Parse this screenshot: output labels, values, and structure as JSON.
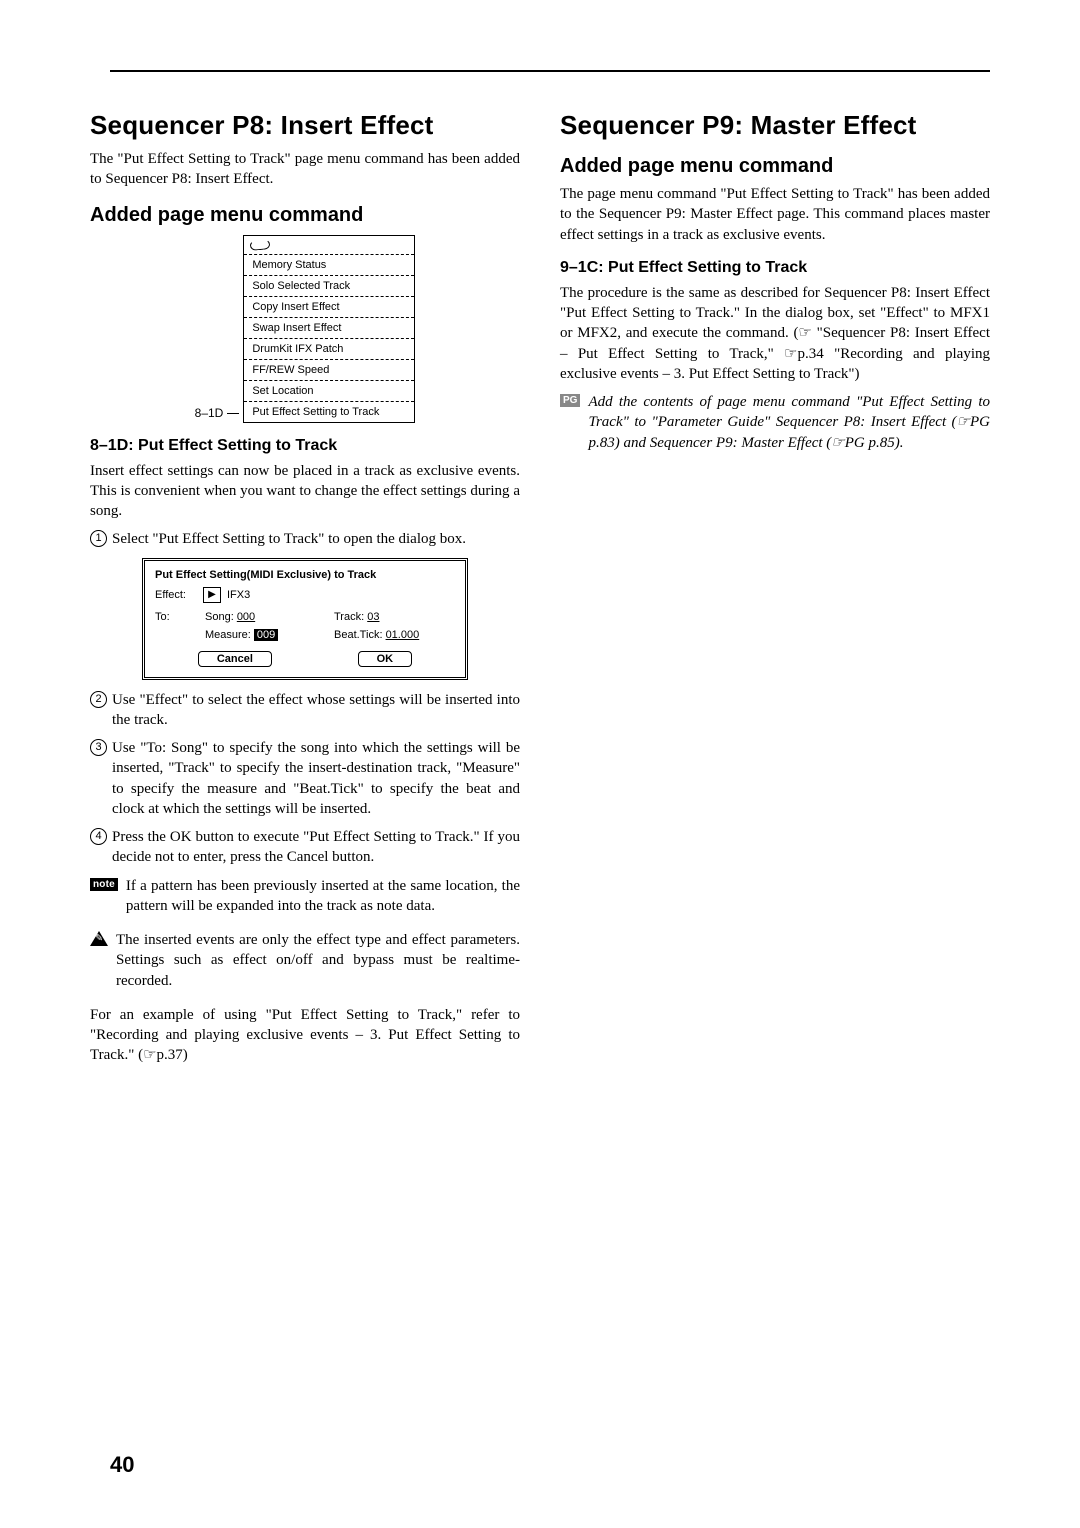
{
  "page_number": "40",
  "left": {
    "h1": "Sequencer P8: Insert Effect",
    "intro": "The \"Put Effect Setting to Track\" page menu command has been added to Sequencer P8: Insert Effect.",
    "h2": "Added page menu command",
    "menu_label": "8–1D",
    "menu_items": [
      "Memory Status",
      "Solo Selected Track",
      "Copy Insert Effect",
      "Swap Insert Effect",
      "DrumKit IFX Patch",
      "FF/REW Speed",
      "Set Location",
      "Put Effect Setting to Track"
    ],
    "h3": "8–1D: Put Effect Setting to Track",
    "p_after_h3": "Insert effect settings can now be placed in a track as exclusive events. This is convenient when you want to change the effect settings during a song.",
    "steps": [
      "Select \"Put Effect Setting to Track\" to open the dialog box.",
      "Use \"Effect\" to select the effect whose settings will be inserted into the track.",
      "Use \"To: Song\" to specify the song into which the settings will be inserted, \"Track\" to specify the insert-destination track, \"Measure\" to specify the measure and \"Beat.Tick\" to specify the beat and clock at which the settings will be inserted.",
      "Press the OK button to execute \"Put Effect Setting to Track.\" If you decide not to enter, press the Cancel button."
    ],
    "dialog": {
      "title": "Put Effect Setting(MIDI Exclusive) to Track",
      "effect_label": "Effect:",
      "effect_value": "IFX3",
      "to_label": "To:",
      "song_label": "Song:",
      "song_value": "000",
      "track_label": "Track:",
      "track_value": "03",
      "measure_label": "Measure:",
      "measure_value": "009",
      "beat_label": "Beat.Tick:",
      "beat_value": "01.000",
      "cancel": "Cancel",
      "ok": "OK"
    },
    "note_badge": "note",
    "note_text": "If a pattern has been previously inserted at the same location, the pattern will be expanded into the track as note data.",
    "warn_text": "The inserted events are only the effect type and effect parameters. Settings such as effect on/off and bypass must be realtime-recorded.",
    "closing": "For an example of using \"Put Effect Setting to Track,\" refer to \"Recording and playing exclusive events – 3. Put Effect Setting to Track.\" (☞p.37)"
  },
  "right": {
    "h1": "Sequencer P9: Master Effect",
    "h2": "Added page menu command",
    "intro": "The page menu command \"Put Effect Setting to Track\" has been added to the Sequencer P9: Master Effect page. This command places master effect settings in a track as exclusive events.",
    "h3": "9–1C: Put Effect Setting to Track",
    "body": "The procedure is the same as described for Sequencer P8: Insert Effect \"Put Effect Setting to Track.\" In the dialog box, set \"Effect\" to MFX1 or MFX2, and execute the command. (☞ \"Sequencer P8: Insert Effect – Put Effect Setting to Track,\" ☞p.34 \"Recording and playing exclusive events – 3. Put Effect Setting to Track\")",
    "pg_badge": "PG",
    "pg_text": "Add the contents of page menu command \"Put Effect Setting to Track\" to \"Parameter Guide\" Sequencer P8: Insert Effect (☞PG p.83) and Sequencer P9: Master Effect (☞PG p.85)."
  }
}
